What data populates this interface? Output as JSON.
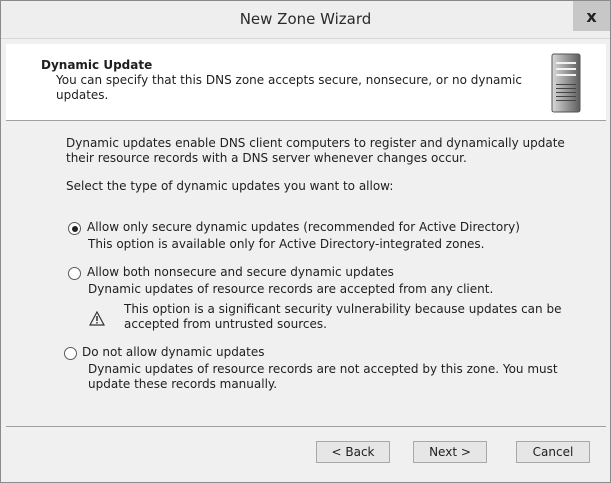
{
  "window": {
    "title": "New Zone Wizard",
    "close_label": "x"
  },
  "header": {
    "title": "Dynamic Update",
    "description": "You can specify that this DNS zone accepts secure, nonsecure, or no dynamic updates.",
    "icon": "server-icon"
  },
  "intro": "Dynamic updates enable DNS client computers to register and dynamically update their resource records with a DNS server whenever changes occur.",
  "prompt": "Select the type of dynamic updates you want to allow:",
  "options": [
    {
      "label": "Allow only secure dynamic updates (recommended for Active Directory)",
      "note": "This option is available only for Active Directory-integrated zones.",
      "selected": true
    },
    {
      "label": "Allow both nonsecure and secure dynamic updates",
      "note": "Dynamic updates of resource records are accepted from any client.",
      "warning": "This option is a significant security vulnerability because updates can be accepted from untrusted sources.",
      "selected": false
    },
    {
      "label": "Do not allow dynamic updates",
      "note": "Dynamic updates of resource records are not accepted by this zone. You must update these records manually.",
      "selected": false
    }
  ],
  "buttons": {
    "back": "< Back",
    "next": "Next >",
    "cancel": "Cancel"
  }
}
